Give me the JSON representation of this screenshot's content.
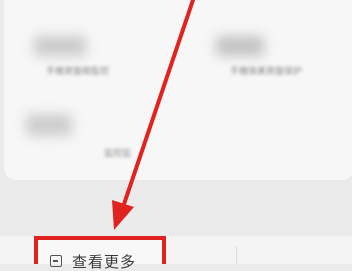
{
  "menu": {
    "item_1_label": "手機資盤檢監控",
    "item_2_label": "手機換美資盤保护",
    "item_3_label": "监控监"
  },
  "view_more": {
    "label": "查看更多"
  },
  "colors": {
    "annotation_red": "#e1231f"
  },
  "icons": {
    "view_more_icon": "minus-square-icon"
  }
}
